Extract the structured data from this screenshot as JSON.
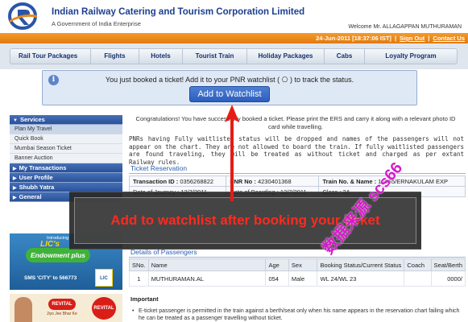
{
  "header": {
    "org_name": "Indian Railway Catering and Tourism Corporation Limited",
    "org_sub": "A Government of India Enterprise",
    "welcome": "Welcome Mr. ALLAGAPPAN MUTHURAMAN"
  },
  "datebar": {
    "datetime": "24-Jun-2011 [18:37:06 IST]",
    "sep": "|",
    "sign_out": "Sign Out",
    "contact_us": "Contact Us"
  },
  "nav": [
    "Rail Tour Packages",
    "Flights",
    "Hotels",
    "Tourist Train",
    "Holiday Packages",
    "Cabs",
    "Loyalty Program"
  ],
  "banner": {
    "text": "You just booked a ticket! Add it to your PNR watchlist ( ⎔ ) to track the status.",
    "button": "Add to Watchlist"
  },
  "sidebar": {
    "services": "Services",
    "items": [
      "Plan My Travel",
      "Quick Book",
      "Mumbai Season Ticket",
      "Banner Auction"
    ],
    "my_transactions": "My Transactions",
    "user_profile": "User Profile",
    "shubh_yatra": "Shubh Yatra",
    "general": "General"
  },
  "ads": {
    "introducing": "Introducing",
    "lic": "LIC's",
    "endowment": "Endowment plus",
    "sms": "SMS 'CITY' to 566773",
    "lic_badge": "LIC",
    "revital": "REVITAL",
    "revital2": "REVITAL",
    "tagline": "Jiyo Jee Bhar Ke"
  },
  "main": {
    "congrats": "Congratulations! You have successfully booked a ticket. Please print the ERS and carry it along with a relevant photo ID card while travelling.",
    "notice": "PNRs having Fully waitlisted status will be dropped and names of the passengers will not appear on the chart. They are not allowed to board the train. If fully waitlisted passengers are found traveling, they will be treated as without ticket and charged as per extant Railway rules.",
    "ticket_title": "Ticket Reservation",
    "ticket": {
      "transaction_label": "Transaction ID :",
      "transaction_id": "0356268822",
      "pnr_label": "PNR No :",
      "pnr": "4230401368",
      "train_label": "Train No. & Name :",
      "train": "16865/ERNAKULAM EXP",
      "row2a": "Date of Journey : 12/7/2011",
      "row2b": "Date of Boarding : 12/7/2011",
      "row2c": "Class : 3A"
    },
    "overlay_text": "Add to watchlist after booking your ticket",
    "passengers_title": "Details of Passengers",
    "pass_headers": [
      "SNo.",
      "Name",
      "Age",
      "Sex",
      "Booking Status/Current Status",
      "Coach",
      "Seat/Berth"
    ],
    "passengers": [
      {
        "sno": "1",
        "name": "MUTHURAMAN.AL",
        "age": "054",
        "sex": "Male",
        "status": "WL 24/WL 23",
        "coach": "",
        "seat": "0000/"
      }
    ],
    "important_title": "Important",
    "important_text": "E-ticket passenger is permitted in the train against a berth/seat only when his name appears in the reservation chart failing which he can be treated as a passenger travelling without ticket."
  },
  "watermark": "数据来源 scs66",
  "colors": {
    "brand_blue": "#1c3f8f",
    "orange": "#e98a1e",
    "overlay_red": "#ff2a1f",
    "watermark": "#d51ac9"
  }
}
